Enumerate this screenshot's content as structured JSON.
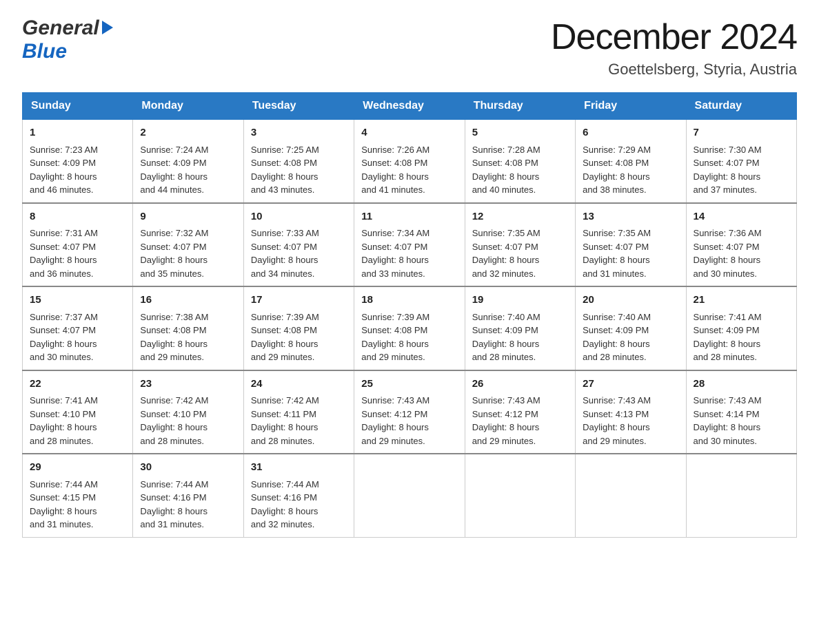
{
  "header": {
    "logo_general": "General",
    "logo_arrow": "▶",
    "logo_blue": "Blue",
    "month_title": "December 2024",
    "location": "Goettelsberg, Styria, Austria"
  },
  "days_of_week": [
    "Sunday",
    "Monday",
    "Tuesday",
    "Wednesday",
    "Thursday",
    "Friday",
    "Saturday"
  ],
  "weeks": [
    [
      {
        "day": "1",
        "info": "Sunrise: 7:23 AM\nSunset: 4:09 PM\nDaylight: 8 hours\nand 46 minutes."
      },
      {
        "day": "2",
        "info": "Sunrise: 7:24 AM\nSunset: 4:09 PM\nDaylight: 8 hours\nand 44 minutes."
      },
      {
        "day": "3",
        "info": "Sunrise: 7:25 AM\nSunset: 4:08 PM\nDaylight: 8 hours\nand 43 minutes."
      },
      {
        "day": "4",
        "info": "Sunrise: 7:26 AM\nSunset: 4:08 PM\nDaylight: 8 hours\nand 41 minutes."
      },
      {
        "day": "5",
        "info": "Sunrise: 7:28 AM\nSunset: 4:08 PM\nDaylight: 8 hours\nand 40 minutes."
      },
      {
        "day": "6",
        "info": "Sunrise: 7:29 AM\nSunset: 4:08 PM\nDaylight: 8 hours\nand 38 minutes."
      },
      {
        "day": "7",
        "info": "Sunrise: 7:30 AM\nSunset: 4:07 PM\nDaylight: 8 hours\nand 37 minutes."
      }
    ],
    [
      {
        "day": "8",
        "info": "Sunrise: 7:31 AM\nSunset: 4:07 PM\nDaylight: 8 hours\nand 36 minutes."
      },
      {
        "day": "9",
        "info": "Sunrise: 7:32 AM\nSunset: 4:07 PM\nDaylight: 8 hours\nand 35 minutes."
      },
      {
        "day": "10",
        "info": "Sunrise: 7:33 AM\nSunset: 4:07 PM\nDaylight: 8 hours\nand 34 minutes."
      },
      {
        "day": "11",
        "info": "Sunrise: 7:34 AM\nSunset: 4:07 PM\nDaylight: 8 hours\nand 33 minutes."
      },
      {
        "day": "12",
        "info": "Sunrise: 7:35 AM\nSunset: 4:07 PM\nDaylight: 8 hours\nand 32 minutes."
      },
      {
        "day": "13",
        "info": "Sunrise: 7:35 AM\nSunset: 4:07 PM\nDaylight: 8 hours\nand 31 minutes."
      },
      {
        "day": "14",
        "info": "Sunrise: 7:36 AM\nSunset: 4:07 PM\nDaylight: 8 hours\nand 30 minutes."
      }
    ],
    [
      {
        "day": "15",
        "info": "Sunrise: 7:37 AM\nSunset: 4:07 PM\nDaylight: 8 hours\nand 30 minutes."
      },
      {
        "day": "16",
        "info": "Sunrise: 7:38 AM\nSunset: 4:08 PM\nDaylight: 8 hours\nand 29 minutes."
      },
      {
        "day": "17",
        "info": "Sunrise: 7:39 AM\nSunset: 4:08 PM\nDaylight: 8 hours\nand 29 minutes."
      },
      {
        "day": "18",
        "info": "Sunrise: 7:39 AM\nSunset: 4:08 PM\nDaylight: 8 hours\nand 29 minutes."
      },
      {
        "day": "19",
        "info": "Sunrise: 7:40 AM\nSunset: 4:09 PM\nDaylight: 8 hours\nand 28 minutes."
      },
      {
        "day": "20",
        "info": "Sunrise: 7:40 AM\nSunset: 4:09 PM\nDaylight: 8 hours\nand 28 minutes."
      },
      {
        "day": "21",
        "info": "Sunrise: 7:41 AM\nSunset: 4:09 PM\nDaylight: 8 hours\nand 28 minutes."
      }
    ],
    [
      {
        "day": "22",
        "info": "Sunrise: 7:41 AM\nSunset: 4:10 PM\nDaylight: 8 hours\nand 28 minutes."
      },
      {
        "day": "23",
        "info": "Sunrise: 7:42 AM\nSunset: 4:10 PM\nDaylight: 8 hours\nand 28 minutes."
      },
      {
        "day": "24",
        "info": "Sunrise: 7:42 AM\nSunset: 4:11 PM\nDaylight: 8 hours\nand 28 minutes."
      },
      {
        "day": "25",
        "info": "Sunrise: 7:43 AM\nSunset: 4:12 PM\nDaylight: 8 hours\nand 29 minutes."
      },
      {
        "day": "26",
        "info": "Sunrise: 7:43 AM\nSunset: 4:12 PM\nDaylight: 8 hours\nand 29 minutes."
      },
      {
        "day": "27",
        "info": "Sunrise: 7:43 AM\nSunset: 4:13 PM\nDaylight: 8 hours\nand 29 minutes."
      },
      {
        "day": "28",
        "info": "Sunrise: 7:43 AM\nSunset: 4:14 PM\nDaylight: 8 hours\nand 30 minutes."
      }
    ],
    [
      {
        "day": "29",
        "info": "Sunrise: 7:44 AM\nSunset: 4:15 PM\nDaylight: 8 hours\nand 31 minutes."
      },
      {
        "day": "30",
        "info": "Sunrise: 7:44 AM\nSunset: 4:16 PM\nDaylight: 8 hours\nand 31 minutes."
      },
      {
        "day": "31",
        "info": "Sunrise: 7:44 AM\nSunset: 4:16 PM\nDaylight: 8 hours\nand 32 minutes."
      },
      {
        "day": "",
        "info": ""
      },
      {
        "day": "",
        "info": ""
      },
      {
        "day": "",
        "info": ""
      },
      {
        "day": "",
        "info": ""
      }
    ]
  ]
}
